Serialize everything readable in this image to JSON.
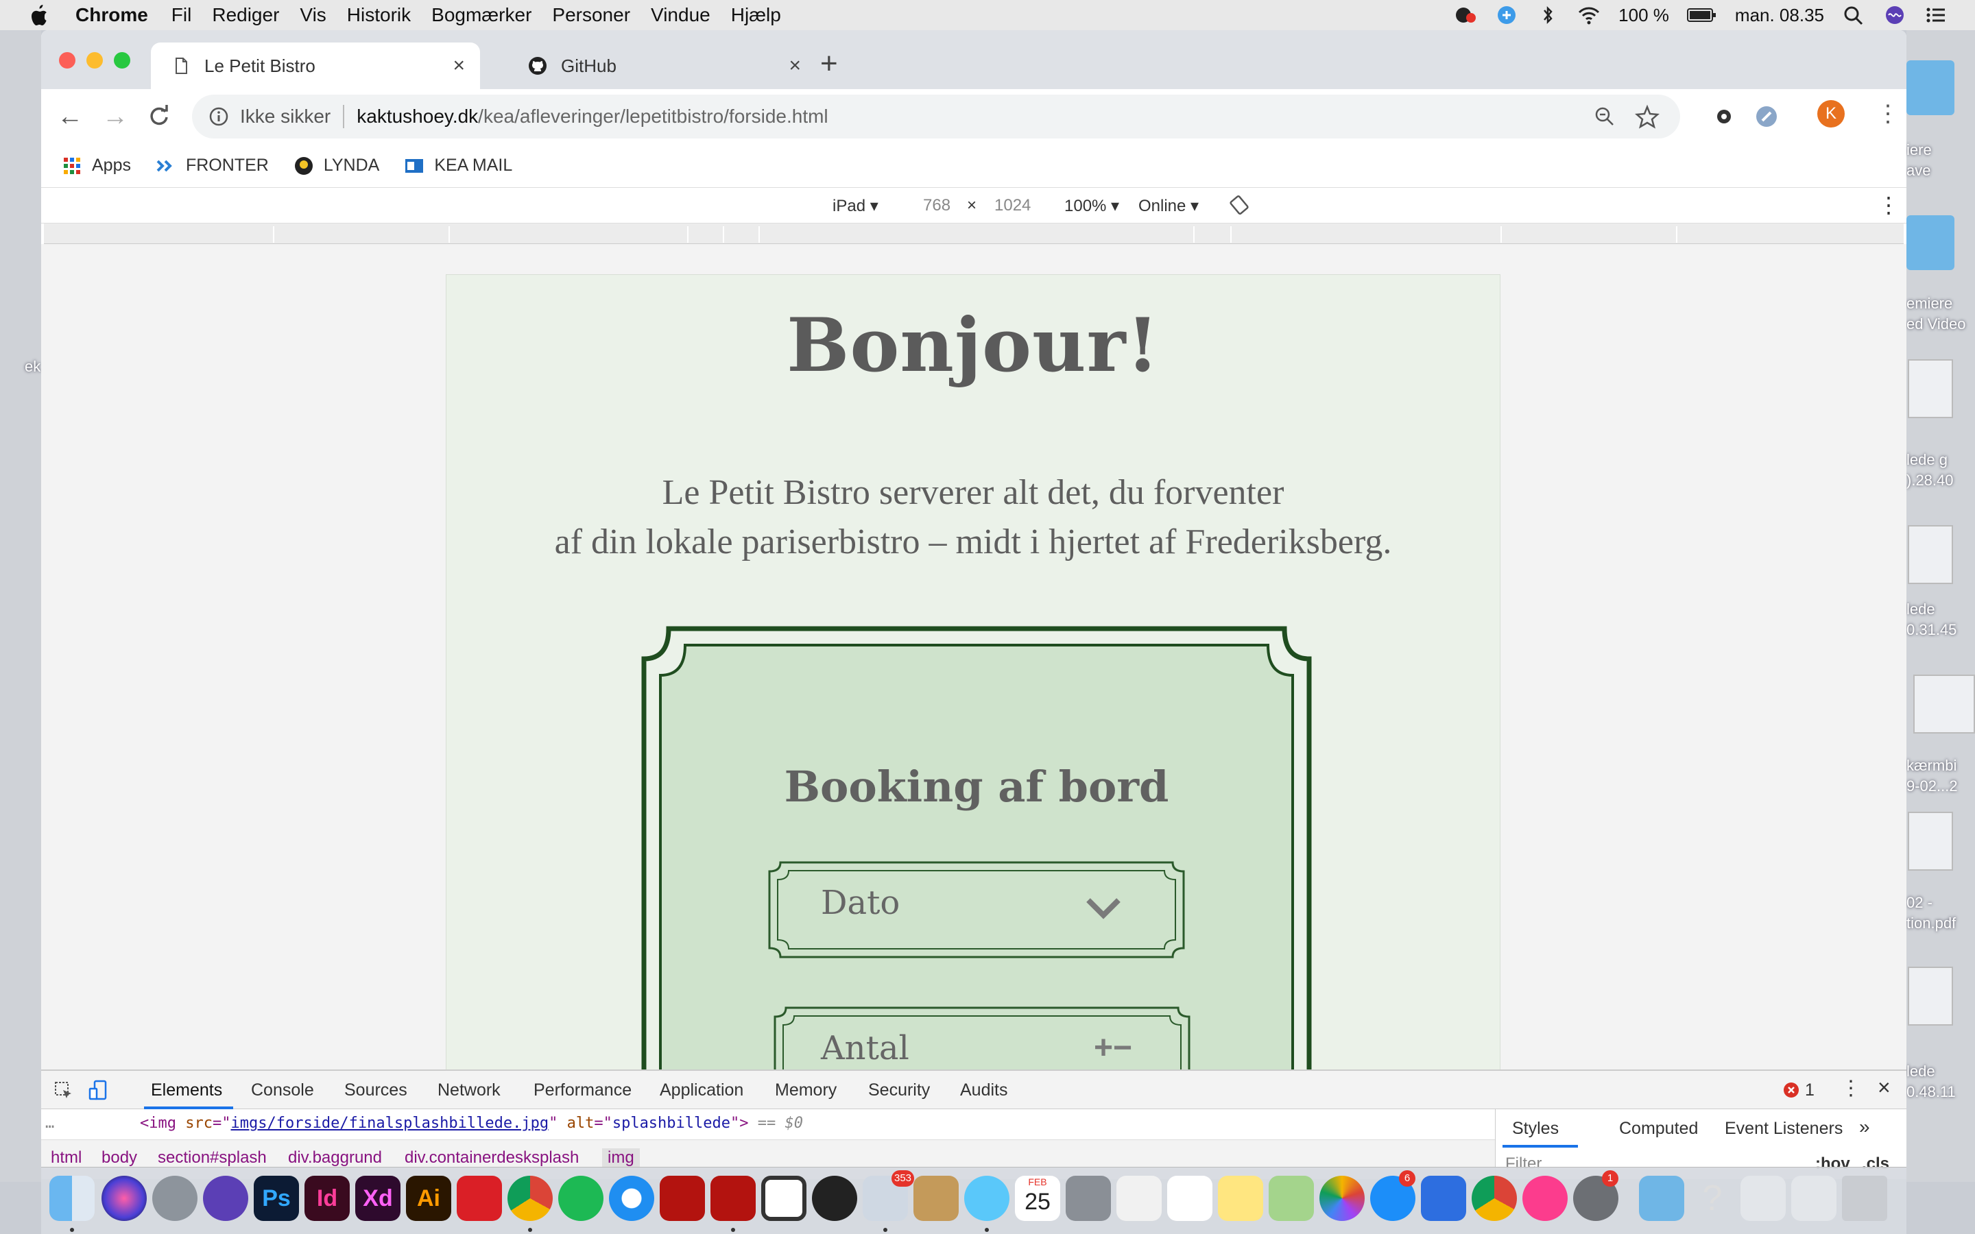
{
  "menubar": {
    "app_name": "Chrome",
    "items": [
      "Fil",
      "Rediger",
      "Vis",
      "Historik",
      "Bogmærker",
      "Personer",
      "Vindue",
      "Hjælp"
    ],
    "battery": "100 %",
    "clock": "man. 08.35"
  },
  "desktop": {
    "left_label": "ek",
    "right_labels": [
      "iere",
      "ave",
      "emiere",
      "ed Video",
      "lede g",
      ").28.40",
      "lede",
      "0.31.45",
      "kærmbi",
      "9-02...2",
      "02 -",
      "tion.pdf",
      "lede",
      "0.48.11"
    ]
  },
  "tabs": [
    {
      "title": "Le Petit Bistro",
      "active": true
    },
    {
      "title": "GitHub",
      "active": false
    }
  ],
  "omnibox": {
    "security_label": "Ikke sikker",
    "host": "kaktushoey.dk",
    "path": "/kea/afleveringer/lepetitbistro/forside.html"
  },
  "profile_initial": "K",
  "bookmarks": [
    "Apps",
    "FRONTER",
    "LYNDA",
    "KEA MAIL"
  ],
  "device_toolbar": {
    "device": "iPad ▾",
    "width": "768",
    "times": "×",
    "height": "1024",
    "zoom": "100% ▾",
    "network": "Online ▾"
  },
  "page": {
    "heading": "Bonjour!",
    "intro_line1": "Le Petit Bistro serverer alt det, du forventer",
    "intro_line2": "af din lokale pariserbistro – midt i hjertet af Frederiksberg.",
    "booking_title": "Booking af bord",
    "field_date": "Dato",
    "field_count": "Antal",
    "count_controls": "+−"
  },
  "devtools": {
    "tabs": [
      "Elements",
      "Console",
      "Sources",
      "Network",
      "Performance",
      "Application",
      "Memory",
      "Security",
      "Audits"
    ],
    "error_count": "1",
    "code": {
      "tag_open": "<img ",
      "src_attr": "src",
      "src_value": "imgs/forside/finalsplashbillede.jpg",
      "alt_attr": "alt",
      "alt_value": "splashbillede",
      "tag_close": ">",
      "selected_marker": "== $0"
    },
    "breadcrumbs": [
      "html",
      "body",
      "section#splash",
      "div.baggrund",
      "div.containerdesksplash",
      "img"
    ],
    "side_tabs": [
      "Styles",
      "Computed",
      "Event Listeners"
    ],
    "filter_placeholder": "Filter",
    "hov": ":hov",
    "cls": ".cls"
  },
  "dock": {
    "app_labels": [
      "Ps",
      "Id",
      "Xd",
      "Ai"
    ],
    "badges": [
      "353",
      "6",
      "1"
    ],
    "calendar_month": "FEB",
    "calendar_day": "25"
  },
  "colors": {
    "page_bg": "#ebf2e9",
    "card_fill": "#cfe3cc",
    "card_border": "#1f4d1f",
    "accent_blue": "#1a73e8",
    "avatar": "#e8711f"
  }
}
